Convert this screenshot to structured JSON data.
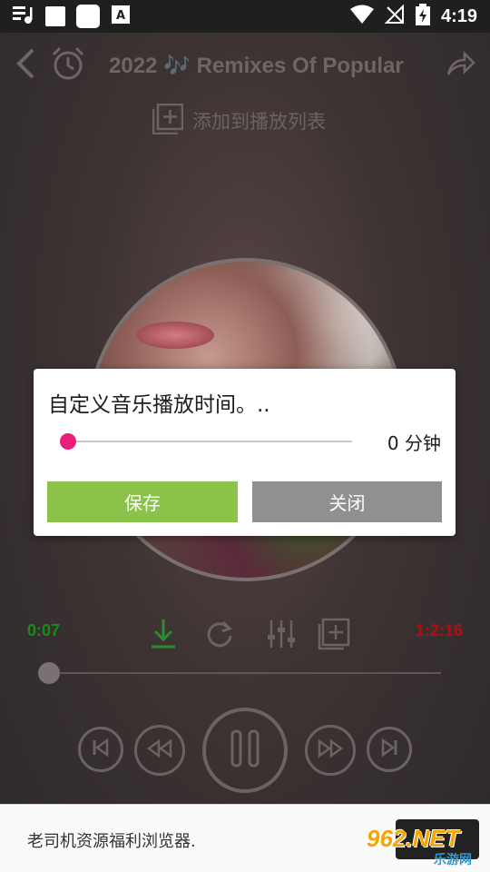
{
  "status_bar": {
    "time": "4:19",
    "icons": [
      "music-queue-icon",
      "app-icon",
      "app-icon",
      "a-notification-icon",
      "wifi-icon",
      "no-signal-icon",
      "battery-charging-icon"
    ]
  },
  "header": {
    "title": "2022 🎶 Remixes Of Popular",
    "add_to_playlist": "添加到播放列表"
  },
  "dialog": {
    "title": "自定义音乐播放时间。..",
    "slider_value_label": "0 分钟",
    "slider_value": 0,
    "save_label": "保存",
    "close_label": "关闭"
  },
  "player": {
    "elapsed": "0:07",
    "duration": "1:2:16",
    "progress": 0
  },
  "ad": {
    "text": "老司机资源福利浏览器.",
    "logo_text": "962.NET",
    "logo_sub": "乐游网"
  },
  "colors": {
    "accent_pink": "#ed1e79",
    "save_green": "#8bc34a",
    "close_gray": "#909090",
    "elapsed_green": "#1a8a1a",
    "duration_red": "#b01010"
  }
}
